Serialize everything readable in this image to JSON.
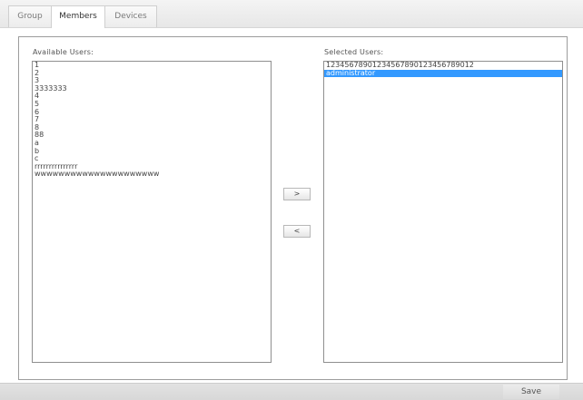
{
  "tabs": [
    {
      "label": "Group",
      "active": false
    },
    {
      "label": "Members",
      "active": true
    },
    {
      "label": "Devices",
      "active": false
    }
  ],
  "available": {
    "label": "Available Users:",
    "items": [
      "1",
      "2",
      "3",
      "3333333",
      "4",
      "5",
      "6",
      "7",
      "8",
      "88",
      "a",
      "b",
      "c",
      "rrrrrrrrrrrrrrr",
      "wwwwwwwwwwwwwwwwwwwww"
    ]
  },
  "selected": {
    "label": "Selected Users:",
    "items": [
      "12345678901234567890123456789012",
      "administrator"
    ],
    "selected_index": 1
  },
  "buttons": {
    "add": ">",
    "remove": "<",
    "save": "Save"
  },
  "colors": {
    "selection": "#3399ff",
    "border": "#8f8f8f"
  }
}
